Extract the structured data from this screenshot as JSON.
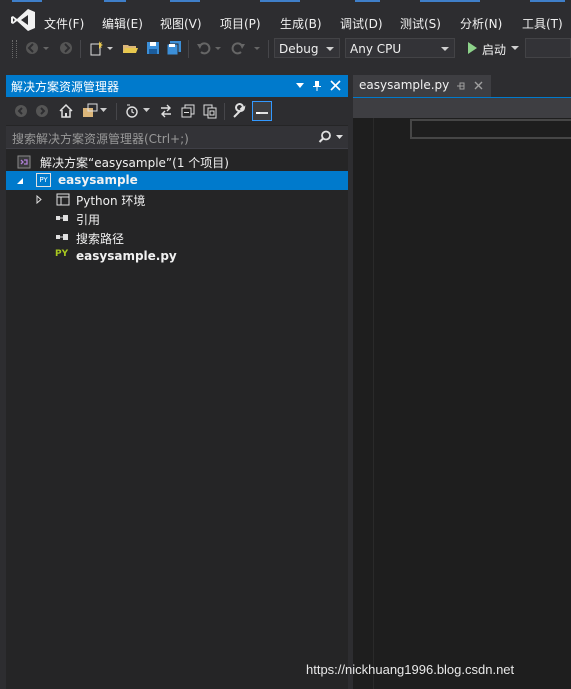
{
  "menu": [
    "文件(F)",
    "编辑(E)",
    "视图(V)",
    "项目(P)",
    "生成(B)",
    "调试(D)",
    "测试(S)",
    "分析(N)",
    "工具(T)"
  ],
  "toolbar": {
    "configuration": "Debug",
    "platform": "Any CPU",
    "start_label": "启动"
  },
  "solution_explorer": {
    "title": "解决方案资源管理器",
    "search_placeholder": "搜索解决方案资源管理器(Ctrl+;)",
    "tree": [
      {
        "label": "解决方案“easysample”(1 个项目)"
      },
      {
        "label": "easysample",
        "badge": "PY"
      },
      {
        "label": "Python 环境"
      },
      {
        "label": "引用"
      },
      {
        "label": "搜索路径"
      },
      {
        "label": "easysample.py",
        "badge": "PY"
      }
    ]
  },
  "editor": {
    "tab_label": "easysample.py"
  },
  "watermark": "https://nickhuang1996.blog.csdn.net",
  "colors": {
    "accent": "#007acc",
    "background": "#2d2d30",
    "editor_bg": "#1e1e1e",
    "python_badge": "#a8c820",
    "play_green": "#8dd28a"
  }
}
